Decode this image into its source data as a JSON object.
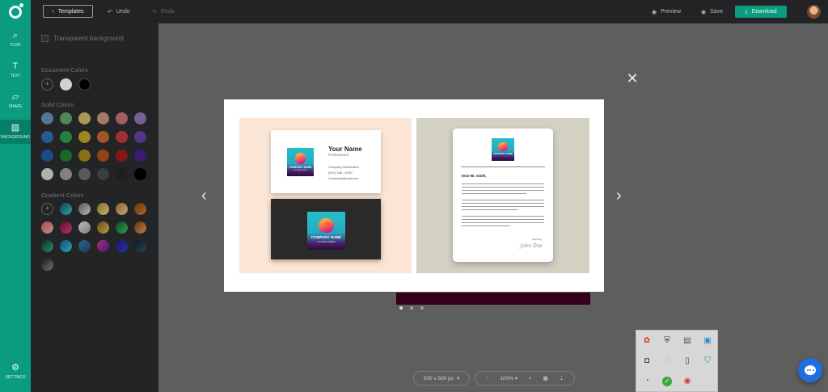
{
  "topbar": {
    "templates_label": "Templates",
    "undo_label": "Undo",
    "redo_label": "Redo",
    "preview_label": "Preview",
    "save_label": "Save",
    "download_label": "Download"
  },
  "rail": {
    "items": [
      {
        "label": "ICON",
        "icon": "search-icon"
      },
      {
        "label": "TEXT",
        "icon": "text-icon"
      },
      {
        "label": "SHAPE",
        "icon": "shape-icon"
      },
      {
        "label": "BACKGROUND",
        "icon": "background-icon"
      }
    ],
    "settings_label": "SETTINGS"
  },
  "panel": {
    "transparent_label": "Transparent background",
    "document_colors_title": "Document Colors",
    "solid_colors_title": "Solid Colors",
    "gradient_colors_title": "Gradient Colors",
    "document_colors": [
      "#ffffff",
      "#000000"
    ],
    "solid_colors": [
      "#6c8fb5",
      "#6aa36e",
      "#cdbb6a",
      "#c99579",
      "#c2737a",
      "#8f76b3",
      "#2f6fae",
      "#2e9b45",
      "#c5a32a",
      "#c66a2e",
      "#c53b3b",
      "#6b3fa6",
      "#1f5fa3",
      "#1e7f2f",
      "#a88a1c",
      "#b3521c",
      "#a41d1d",
      "#4a228a",
      "#d8d8d8",
      "#9e9e9e",
      "#6e6e6e",
      "#4a4a4a",
      "#262626",
      "#000000"
    ]
  },
  "modal": {
    "card_name": "Your Name",
    "card_role": "Professional",
    "card_line1": "Company information",
    "card_line2": "(012) 345 - 6789",
    "card_line3": "Company@mail.com",
    "logo_word": "COMPANY NAME",
    "logo_sub": "SLOGAN HERE",
    "letter_greeting": "Dear Mr. Smith,",
    "letter_closing": "Sincerely,",
    "letter_signature": "John Doe"
  },
  "bottom": {
    "canvas_size": "500 x 500 px",
    "zoom_minus": "−",
    "zoom_value": "100%",
    "zoom_plus": "+"
  }
}
